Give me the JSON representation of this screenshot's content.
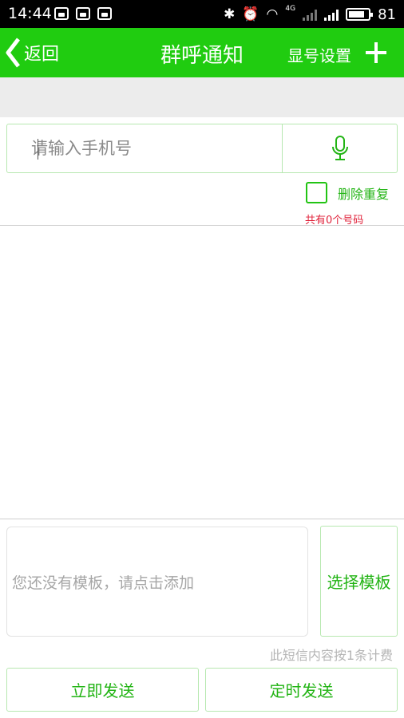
{
  "status_bar": {
    "time": "14:44",
    "network_label": "4G",
    "battery": "81",
    "battery_level": 0.81
  },
  "header": {
    "back_label": "返回",
    "title": "群呼通知",
    "display_settings_label": "显号设置",
    "add_icon": "plus-icon",
    "bg_color": "#20cc10"
  },
  "recipients": {
    "phone_placeholder": "请输入手机号",
    "mic_icon": "microphone-icon",
    "dedup_label": "删除重复",
    "count_text": "共有0个号码"
  },
  "template": {
    "placeholder": "您还没有模板，请点击添加",
    "select_label": "选择模板",
    "billing_note": "此短信内容按1条计费"
  },
  "actions": {
    "send_now_label": "立即发送",
    "send_timed_label": "定时发送"
  },
  "colors": {
    "accent": "#22b414",
    "border": "#b7e8b0",
    "count_red": "#e0223a"
  }
}
